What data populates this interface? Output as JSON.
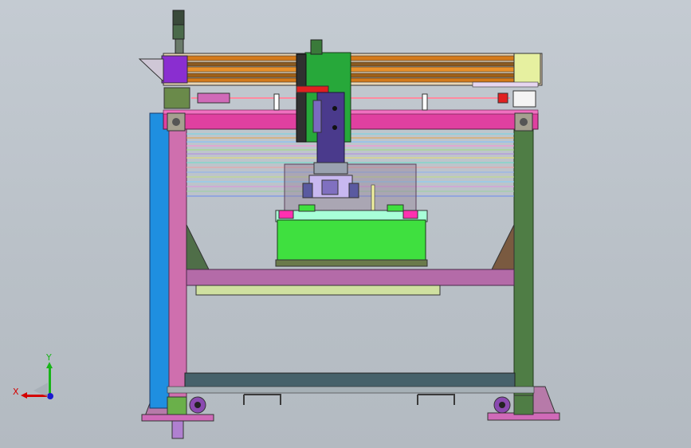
{
  "viewport": {
    "background": "#bfc6cd",
    "model": "gantry-frame-assembly"
  },
  "triad": {
    "x_label": "X",
    "y_label": "Y",
    "x_color": "#d40000",
    "y_color": "#18b418",
    "z_color": "#1a1ad0"
  },
  "colors": {
    "frame_green": "#4f7d45",
    "left_post": "#1f8fe0",
    "pink_post": "#cf6fae",
    "beam_magenta": "#e040a0",
    "rail_orange": "#d47a1a",
    "carriage_green": "#27a83a",
    "ram_purple": "#4a3a8c",
    "box_lime": "#3fe03f",
    "base_pink": "#b46ba8",
    "shelf_yellow": "#cfe0a0",
    "laser_red": "#e12020"
  }
}
